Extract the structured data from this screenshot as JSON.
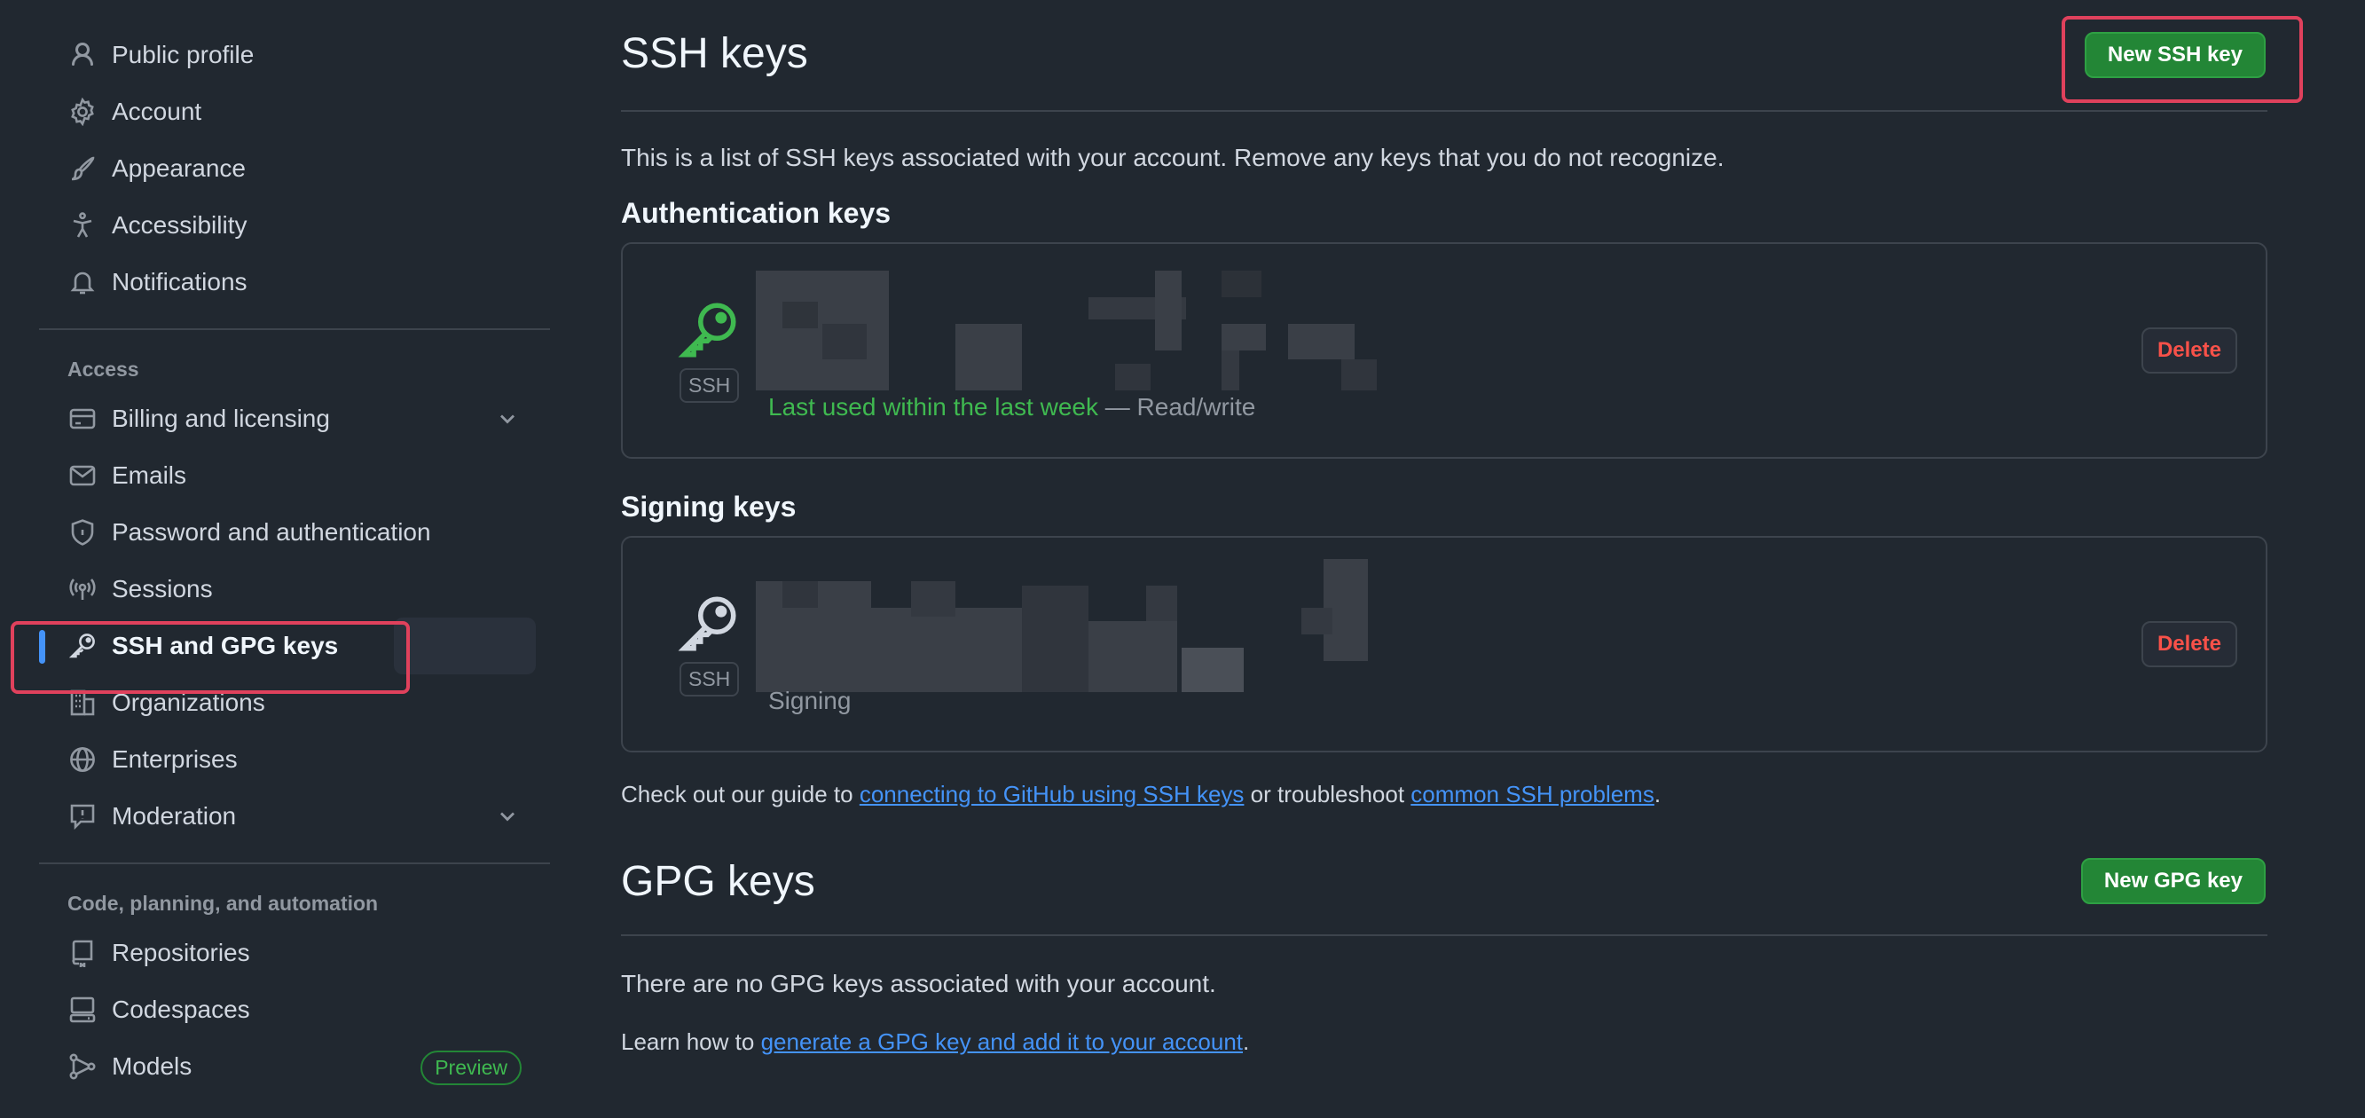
{
  "sidebar": {
    "top_items": [
      {
        "label": "Public profile",
        "icon": "person-icon"
      },
      {
        "label": "Account",
        "icon": "gear-icon"
      },
      {
        "label": "Appearance",
        "icon": "paintbrush-icon"
      },
      {
        "label": "Accessibility",
        "icon": "accessibility-icon"
      },
      {
        "label": "Notifications",
        "icon": "bell-icon"
      }
    ],
    "access_heading": "Access",
    "access_items": [
      {
        "label": "Billing and licensing",
        "icon": "credit-card-icon",
        "expandable": true
      },
      {
        "label": "Emails",
        "icon": "mail-icon"
      },
      {
        "label": "Password and authentication",
        "icon": "shield-lock-icon"
      },
      {
        "label": "Sessions",
        "icon": "broadcast-icon"
      },
      {
        "label": "SSH and GPG keys",
        "icon": "key-icon",
        "active": true
      },
      {
        "label": "Organizations",
        "icon": "organization-icon"
      },
      {
        "label": "Enterprises",
        "icon": "globe-icon"
      },
      {
        "label": "Moderation",
        "icon": "report-icon",
        "expandable": true
      }
    ],
    "code_heading": "Code, planning, and automation",
    "code_items": [
      {
        "label": "Repositories",
        "icon": "repo-icon"
      },
      {
        "label": "Codespaces",
        "icon": "codespaces-icon"
      },
      {
        "label": "Models",
        "icon": "models-icon",
        "badge": "Preview"
      }
    ]
  },
  "ssh": {
    "title": "SSH keys",
    "new_button": "New SSH key",
    "intro": "This is a list of SSH keys associated with your account. Remove any keys that you do not recognize.",
    "auth_heading": "Authentication keys",
    "auth_key": {
      "tag": "SSH",
      "last_used": "Last used within the last week",
      "access": " — Read/write",
      "delete": "Delete"
    },
    "signing_heading": "Signing keys",
    "signing_key": {
      "tag": "SSH",
      "meta": "Signing",
      "delete": "Delete"
    },
    "guide_prefix": "Check out our guide to ",
    "guide_link1": "connecting to GitHub using SSH keys",
    "guide_middle": " or troubleshoot ",
    "guide_link2": "common SSH problems",
    "guide_suffix": "."
  },
  "gpg": {
    "title": "GPG keys",
    "new_button": "New GPG key",
    "empty": "There are no GPG keys associated with your account.",
    "learn_prefix": "Learn how to ",
    "learn_link": "generate a GPG key and add it to your account",
    "learn_suffix": "."
  },
  "colors": {
    "background": "#212830",
    "accent_green": "#238636",
    "link_blue": "#4493f8",
    "danger_red": "#f85149",
    "highlight_box": "#e0415c"
  }
}
